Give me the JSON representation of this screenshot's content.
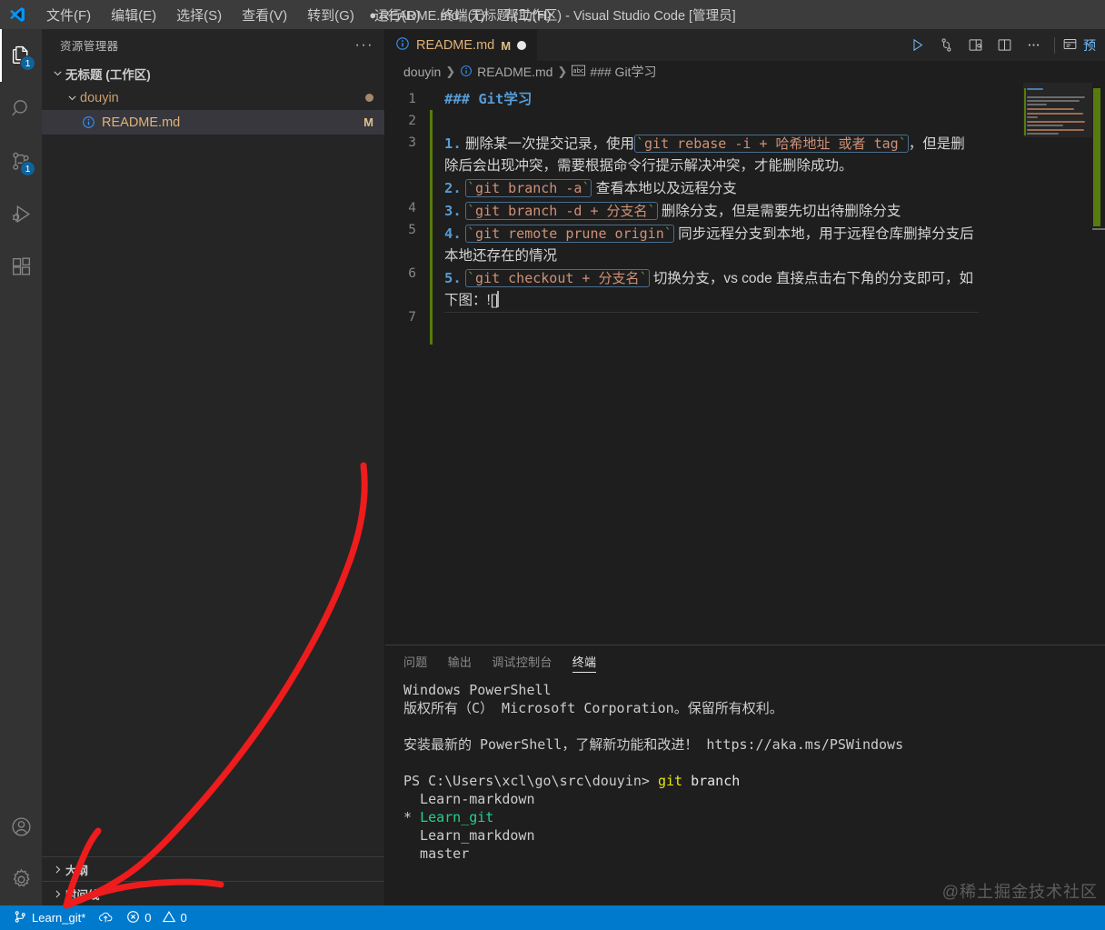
{
  "window": {
    "title": "README.md - 无标题 (工作区) - Visual Studio Code [管理员]",
    "dirty_marker": "●"
  },
  "menubar": {
    "items": [
      {
        "label": "文件(F)",
        "name": "menu-file"
      },
      {
        "label": "编辑(E)",
        "name": "menu-edit"
      },
      {
        "label": "选择(S)",
        "name": "menu-selection"
      },
      {
        "label": "查看(V)",
        "name": "menu-view"
      },
      {
        "label": "转到(G)",
        "name": "menu-go"
      },
      {
        "label": "运行(R)",
        "name": "menu-run"
      },
      {
        "label": "终端(T)",
        "name": "menu-terminal"
      },
      {
        "label": "帮助(H)",
        "name": "menu-help"
      }
    ]
  },
  "activitybar": {
    "items": [
      {
        "icon": "files-explorer-icon",
        "badge": "1",
        "active": true
      },
      {
        "icon": "search-icon",
        "badge": "",
        "active": false
      },
      {
        "icon": "source-control-icon",
        "badge": "1",
        "active": false
      },
      {
        "icon": "run-and-debug-icon",
        "badge": "",
        "active": false
      },
      {
        "icon": "extensions-icon",
        "badge": "",
        "active": false
      }
    ],
    "bottom": [
      {
        "icon": "account-icon"
      },
      {
        "icon": "settings-gear-icon"
      }
    ]
  },
  "sidebar": {
    "title": "资源管理器",
    "more_actions": "···",
    "tree": {
      "workspace": {
        "label": "无标题 (工作区)",
        "expanded": true
      },
      "folder": {
        "label": "douyin",
        "expanded": true,
        "decoration_dot": true
      },
      "file": {
        "label": "README.md",
        "badge": "M",
        "selected": true,
        "icon": "markdown-info-icon"
      }
    },
    "sections": [
      {
        "label": "大纲",
        "expanded": false
      },
      {
        "label": "时间线",
        "expanded": false
      }
    ]
  },
  "editor": {
    "tab": {
      "label": "README.md",
      "badge": "M",
      "dirty": true,
      "icon": "markdown-info-icon"
    },
    "actions": [
      {
        "name": "run-button",
        "icon": "play-icon"
      },
      {
        "name": "source-control-compare-button",
        "icon": "git-compare-icon"
      },
      {
        "name": "open-preview-to-side-button",
        "icon": "preview-side-icon"
      },
      {
        "name": "split-editor-button",
        "icon": "split-editor-icon"
      },
      {
        "name": "more-actions-button",
        "icon": "ellipsis-icon"
      }
    ],
    "preview_panel_label": "预",
    "breadcrumb": [
      {
        "label": "douyin",
        "icon": ""
      },
      {
        "label": "README.md",
        "icon": "markdown-info-icon"
      },
      {
        "label": "### Git学习",
        "icon": "abc-symbol-icon"
      }
    ],
    "line_numbers": [
      "1",
      "2",
      "3",
      "4",
      "5",
      "6",
      "7"
    ],
    "content": {
      "heading": "### Git学习",
      "items": [
        {
          "num": "1.",
          "parts": [
            {
              "type": "text",
              "value": "删除某一次提交记录，使用"
            },
            {
              "type": "code",
              "value": "git rebase -i + 哈希地址 或者 tag"
            },
            {
              "type": "text",
              "value": "，但是删除后会出现冲突，需要根据命令行提示解决冲突，才能删除成功。"
            }
          ]
        },
        {
          "num": "2.",
          "parts": [
            {
              "type": "code",
              "value": "git branch -a"
            },
            {
              "type": "text",
              "value": "查看本地以及远程分支"
            }
          ]
        },
        {
          "num": "3.",
          "parts": [
            {
              "type": "code",
              "value": "git branch -d + 分支名"
            },
            {
              "type": "text",
              "value": "删除分支，但是需要先切出待删除分支"
            }
          ]
        },
        {
          "num": "4.",
          "parts": [
            {
              "type": "code",
              "value": "git remote prune origin"
            },
            {
              "type": "text",
              "value": "同步远程分支到本地，用于远程仓库删掉分支后本地还存在的情况"
            }
          ]
        },
        {
          "num": "5.",
          "parts": [
            {
              "type": "code",
              "value": "git checkout + 分支名"
            },
            {
              "type": "text",
              "value": "切换分支，vs code 直接点击右下角的分支即可，如下图：![]"
            }
          ]
        }
      ]
    }
  },
  "panel": {
    "tabs": [
      {
        "label": "问题",
        "active": false
      },
      {
        "label": "输出",
        "active": false
      },
      {
        "label": "调试控制台",
        "active": false
      },
      {
        "label": "终端",
        "active": true
      }
    ],
    "terminal_lines": [
      {
        "segments": [
          {
            "text": "Windows PowerShell",
            "color": "default"
          }
        ]
      },
      {
        "segments": [
          {
            "text": "版权所有（C） Microsoft Corporation。保留所有权利。",
            "color": "default"
          }
        ]
      },
      {
        "segments": [
          {
            "text": "",
            "color": "default"
          }
        ]
      },
      {
        "segments": [
          {
            "text": "安装最新的 PowerShell，了解新功能和改进！ https://aka.ms/PSWindows",
            "color": "default"
          }
        ]
      },
      {
        "segments": [
          {
            "text": "",
            "color": "default"
          }
        ]
      },
      {
        "segments": [
          {
            "text": "PS C:\\Users\\xcl\\go\\src\\douyin> ",
            "color": "default"
          },
          {
            "text": "git",
            "color": "yellow"
          },
          {
            "text": " branch",
            "color": "white"
          }
        ]
      },
      {
        "segments": [
          {
            "text": "  Learn-markdown",
            "color": "default"
          }
        ]
      },
      {
        "segments": [
          {
            "text": "* ",
            "color": "default"
          },
          {
            "text": "Learn_git",
            "color": "green"
          }
        ]
      },
      {
        "segments": [
          {
            "text": "  Learn_markdown",
            "color": "default"
          }
        ]
      },
      {
        "segments": [
          {
            "text": "  master",
            "color": "default"
          }
        ]
      }
    ]
  },
  "statusbar": {
    "branch": "Learn_git*",
    "branch_icon": "source-control-branch-icon",
    "sync_icon": "cloud-upload-icon",
    "errors": "0",
    "warnings": "0",
    "error_icon": "error-circle-icon",
    "warning_icon": "warning-triangle-icon"
  },
  "annotation": {
    "color": "#ee1c1c",
    "description": "hand-drawn red arrow pointing to branch indicator"
  },
  "watermark": "@稀土掘金技术社区",
  "colors": {
    "accent": "#007acc",
    "titlebar_bg": "#3c3c3c",
    "sidebar_bg": "#252526",
    "editor_bg": "#1e1e1e",
    "activitybar_bg": "#333333",
    "heading_blue": "#569cd6",
    "code_orange": "#ce9178",
    "file_orange": "#e2b278",
    "git_green": "#587c0c",
    "terminal_green": "#23d18b",
    "terminal_yellow": "#e5e510"
  }
}
